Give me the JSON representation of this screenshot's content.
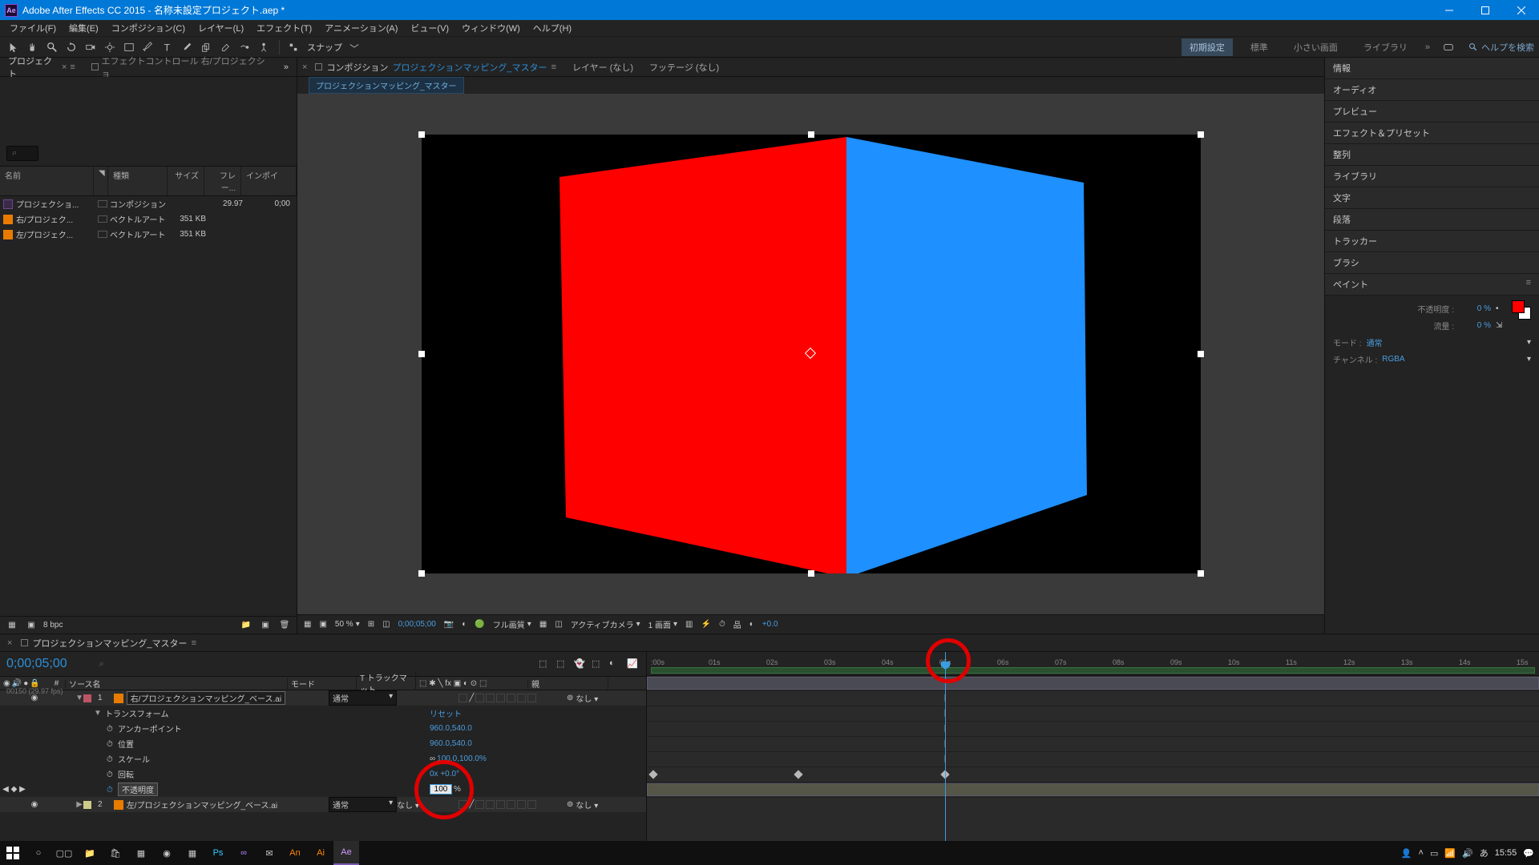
{
  "titlebar": {
    "app": "Ae",
    "title": "Adobe After Effects CC 2015 - 名称未設定プロジェクト.aep *"
  },
  "menu": [
    "ファイル(F)",
    "編集(E)",
    "コンポジション(C)",
    "レイヤー(L)",
    "エフェクト(T)",
    "アニメーション(A)",
    "ビュー(V)",
    "ウィンドウ(W)",
    "ヘルプ(H)"
  ],
  "toolbar": {
    "snap": "スナップ",
    "workspaces": [
      "初期設定",
      "標準",
      "小さい画面",
      "ライブラリ"
    ],
    "active_workspace": 0,
    "help_search": "ヘルプを検索"
  },
  "left": {
    "tabs": {
      "project": "プロジェクト",
      "effect_controls": "エフェクトコントロール 右/プロジェクショ"
    },
    "columns": {
      "name": "名前",
      "type": "種類",
      "size": "サイズ",
      "fr": "フレー...",
      "in": "インポイ"
    },
    "rows": [
      {
        "icon": "comp",
        "name": "プロジェクショ...",
        "type": "コンポジション",
        "size": "",
        "fr": "29.97",
        "in": "0;00"
      },
      {
        "icon": "ai",
        "name": "右/プロジェク...",
        "type": "ベクトルアート",
        "size": "351 KB",
        "fr": "",
        "in": ""
      },
      {
        "icon": "ai",
        "name": "左/プロジェク...",
        "type": "ベクトルアート",
        "size": "351 KB",
        "fr": "",
        "in": ""
      }
    ],
    "footer_bpc": "8 bpc"
  },
  "center": {
    "tabs": {
      "comp_label": "コンポジション",
      "comp_name": "プロジェクションマッピング_マスター",
      "layer": "レイヤー (なし)",
      "footage": "フッテージ (なし)"
    },
    "breadcrumb": "プロジェクションマッピング_マスター",
    "footer": {
      "zoom": "50 %",
      "time": "0;00;05;00",
      "quality": "フル画質",
      "camera": "アクティブカメラ",
      "views": "1 画面",
      "exposure": "+0.0"
    }
  },
  "right": {
    "panels": [
      "情報",
      "オーディオ",
      "プレビュー",
      "エフェクト＆プリセット",
      "整列",
      "ライブラリ",
      "文字",
      "段落",
      "トラッカー",
      "ブラシ"
    ],
    "paint": {
      "title": "ペイント",
      "opacity_lbl": "不透明度 :",
      "opacity_val": "0 %",
      "flow_lbl": "流量 :",
      "flow_val": "0 %",
      "mode_lbl": "モード :",
      "mode_val": "通常",
      "channel_lbl": "チャンネル :",
      "channel_val": "RGBA"
    }
  },
  "timeline": {
    "tab": "プロジェクションマッピング_マスター",
    "timecode": "0;00;05;00",
    "fps": "00150 (29.97 fps)",
    "columns": {
      "source": "ソース名",
      "mode": "モード",
      "trackmatte": "T トラックマット",
      "parent": "親"
    },
    "ruler": [
      ":00s",
      "01s",
      "02s",
      "03s",
      "04s",
      "05s",
      "06s",
      "07s",
      "08s",
      "09s",
      "10s",
      "11s",
      "12s",
      "13s",
      "14s",
      "15s"
    ],
    "layers": [
      {
        "num": "1",
        "name": "右/プロジェクションマッピング_ベース.ai",
        "mode": "通常",
        "parent_none": "なし"
      },
      {
        "num": "2",
        "name": "左/プロジェクションマッピング_ベース.ai",
        "mode": "通常",
        "trk_none": "なし",
        "parent_none": "なし"
      }
    ],
    "transform": {
      "group": "トランスフォーム",
      "reset": "リセット",
      "anchor": "アンカーポイント",
      "anchor_val": "960.0,540.0",
      "position": "位置",
      "position_val": "960.0,540.0",
      "scale": "スケール",
      "scale_val": "100.0,100.0%",
      "rotation": "回転",
      "rotation_val": "0x +0.0°",
      "opacity": "不透明度",
      "opacity_val": "100",
      "opacity_pct": "%"
    }
  },
  "taskbar": {
    "ime": "あ",
    "clock": "15:55"
  }
}
